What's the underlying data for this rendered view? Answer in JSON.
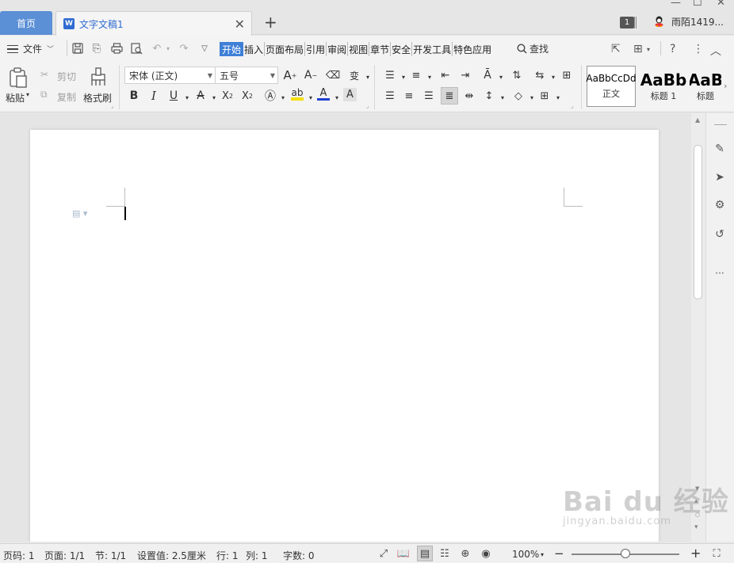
{
  "tabs": {
    "home_label": "首页",
    "doc_label": "文字文稿1",
    "doc_icon": "W",
    "add_label": "+"
  },
  "titlebar": {
    "badge_count": "1",
    "user_name": "雨陌1419..."
  },
  "menu": {
    "file_label": "文件",
    "tabs": [
      "开始",
      "插入",
      "页面布局",
      "引用",
      "审阅",
      "视图",
      "章节",
      "安全",
      "开发工具",
      "特色应用"
    ],
    "search_label": "查找"
  },
  "ribbon": {
    "paste_label": "粘贴",
    "cut_label": "剪切",
    "copy_label": "复制",
    "format_painter_label": "格式刷",
    "font_name": "宋体 (正文)",
    "font_size": "五号",
    "styles": [
      {
        "sample": "AaBbCcDd",
        "name": "正文"
      },
      {
        "sample": "AaBb",
        "name": "标题 1"
      },
      {
        "sample": "AaB",
        "name": "标题"
      }
    ]
  },
  "status": {
    "page_code": "页码: 1",
    "page": "页面: 1/1",
    "section": "节: 1/1",
    "setting": "设置值: 2.5厘米",
    "row": "行: 1",
    "col": "列: 1",
    "word_count": "字数: 0",
    "zoom": "100%",
    "zoom_level": 0.5
  },
  "watermark": {
    "main": "Bai du 经验",
    "sub": "jingyan.baidu.com"
  },
  "colors": {
    "accent": "#3f7fd6",
    "home_tab": "#5b8fd6",
    "font_color_red": "#d23c3c",
    "font_color_blue": "#1f3fd0",
    "highlight_yellow": "#f5e000"
  }
}
